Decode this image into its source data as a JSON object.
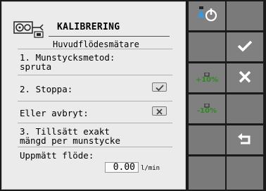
{
  "dialog": {
    "title": "KALIBRERING",
    "subtitle": "Huvudflödesmätare"
  },
  "steps": {
    "step1_label": "1. Munstycksmetod:",
    "step1_value": "spruta",
    "step2_label": "2. Stoppa:",
    "abort_label": "Eller avbryt:",
    "step3_line1": "3. Tillsätt exakt",
    "step3_line2": "mängd per munstycke",
    "measured_label": "Uppmätt flöde:",
    "measured_value": "0.00",
    "measured_unit": "l/min"
  },
  "softkeys": {
    "increase_label": "+10%",
    "decrease_label": "-10%"
  },
  "icons": {
    "header": "sprayer-calibration-icon",
    "confirm": "checkmark-icon",
    "cancel": "x-icon",
    "back": "return-arrow-icon",
    "power": "nozzle-power-icon"
  }
}
